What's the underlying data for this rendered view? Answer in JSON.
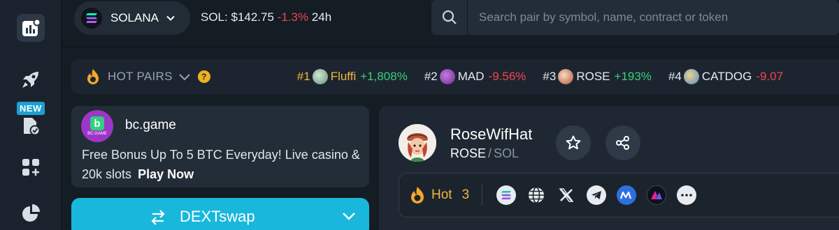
{
  "topbar": {
    "chain": {
      "name": "SOLANA",
      "icon": "solana-logo-icon"
    },
    "price": {
      "label": "SOL:",
      "value": "$142.75",
      "change": "-1.3%",
      "period": "24h"
    },
    "search": {
      "placeholder": "Search pair by symbol, name, contract or token"
    }
  },
  "sidebar": {
    "items": [
      {
        "icon": "chart-icon",
        "active": true
      },
      {
        "icon": "rocket-icon"
      },
      {
        "icon": "document-check-icon",
        "badge": "NEW"
      },
      {
        "icon": "apps-add-icon"
      },
      {
        "icon": "pie-chart-icon"
      }
    ]
  },
  "hot_pairs": {
    "label": "HOT PAIRS",
    "help": "?",
    "items": [
      {
        "rank": "#1",
        "symbol": "Fluffi",
        "change": "+1,808%",
        "direction": "up"
      },
      {
        "rank": "#2",
        "symbol": "MAD",
        "change": "-9.56%",
        "direction": "down"
      },
      {
        "rank": "#3",
        "symbol": "ROSE",
        "change": "+193%",
        "direction": "up"
      },
      {
        "rank": "#4",
        "symbol": "CATDOG",
        "change": "-9.07",
        "direction": "down"
      }
    ]
  },
  "ad": {
    "logo_text": "BC.GAME",
    "name": "bc.game",
    "text": "Free Bonus Up To 5 BTC Everyday! Live casino & 20k slots",
    "cta": "Play Now"
  },
  "swap": {
    "label": "DEXTswap"
  },
  "token": {
    "name": "RoseWifHat",
    "symbol": "ROSE",
    "separator": "/",
    "quote": "SOL",
    "hot_label": "Hot",
    "hot_rank": "3",
    "links": [
      "solana-icon",
      "globe-icon",
      "x-icon",
      "telegram-icon",
      "coinmarketcap-icon",
      "dextools-icon",
      "more-icon"
    ]
  },
  "colors": {
    "accent": "#19b7dc",
    "positive": "#39d17b",
    "negative": "#f0454f",
    "hot": "#f3b73b",
    "badge": "#1f9fd0"
  }
}
